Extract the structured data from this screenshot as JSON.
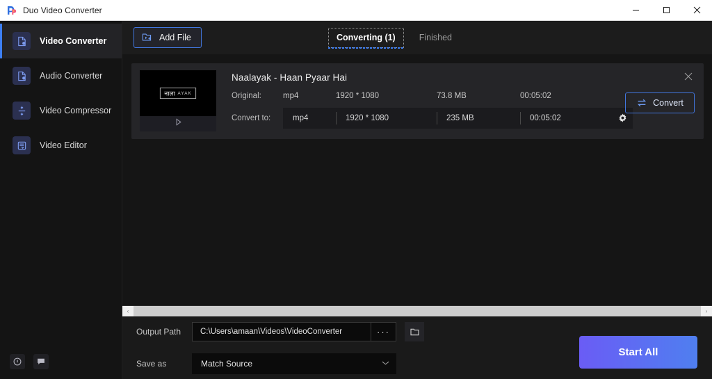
{
  "window": {
    "title": "Duo Video Converter",
    "app_icon": "duo-app-icon",
    "minimize": "minimize",
    "maximize": "maximize",
    "close": "close"
  },
  "sidebar": {
    "items": [
      {
        "label": "Video Converter",
        "icon": "video-file-icon",
        "active": true
      },
      {
        "label": "Audio Converter",
        "icon": "audio-file-icon",
        "active": false
      },
      {
        "label": "Video Compressor",
        "icon": "compress-icon",
        "active": false
      },
      {
        "label": "Video Editor",
        "icon": "edit-icon",
        "active": false
      }
    ],
    "bottom_icons": [
      {
        "name": "info-icon",
        "glyph": "i"
      },
      {
        "name": "feedback-icon",
        "glyph": "chat"
      }
    ]
  },
  "toolbar": {
    "add_file_label": "Add File",
    "add_file_icon": "add-file-folder-icon"
  },
  "tabs": [
    {
      "label": "Converting (1)",
      "active": true
    },
    {
      "label": "Finished",
      "active": false
    }
  ],
  "file_card": {
    "title": "Naalayak - Haan Pyaar Hai",
    "thumbnail": {
      "logo_primary": "नाला",
      "logo_secondary": "AYAK",
      "play_icon": "play-icon"
    },
    "original": {
      "label": "Original:",
      "format": "mp4",
      "resolution": "1920 * 1080",
      "size": "73.8 MB",
      "duration": "00:05:02"
    },
    "convert_to": {
      "label": "Convert to:",
      "format": "mp4",
      "resolution": "1920 * 1080",
      "size": "235 MB",
      "duration": "00:05:02",
      "settings_icon": "gear-icon"
    },
    "convert_button": {
      "label": "Convert",
      "icon": "swap-arrows-icon"
    },
    "close_icon": "close-icon"
  },
  "scrollbar": {
    "left_arrow": "‹",
    "right_arrow": "›"
  },
  "bottom": {
    "output_path_label": "Output Path",
    "output_path_value": "C:\\Users\\amaan\\Videos\\VideoConverter",
    "browse_dots": "···",
    "open_folder_icon": "folder-icon",
    "save_as_label": "Save as",
    "save_as_value": "Match Source",
    "start_all_label": "Start All"
  },
  "colors": {
    "accent_blue": "#3d7ff5",
    "button_border": "#4277e0",
    "start_gradient_from": "#6a5cf5",
    "start_gradient_to": "#4f7ff0",
    "page_bg": "#151515",
    "card_bg": "#252528"
  }
}
